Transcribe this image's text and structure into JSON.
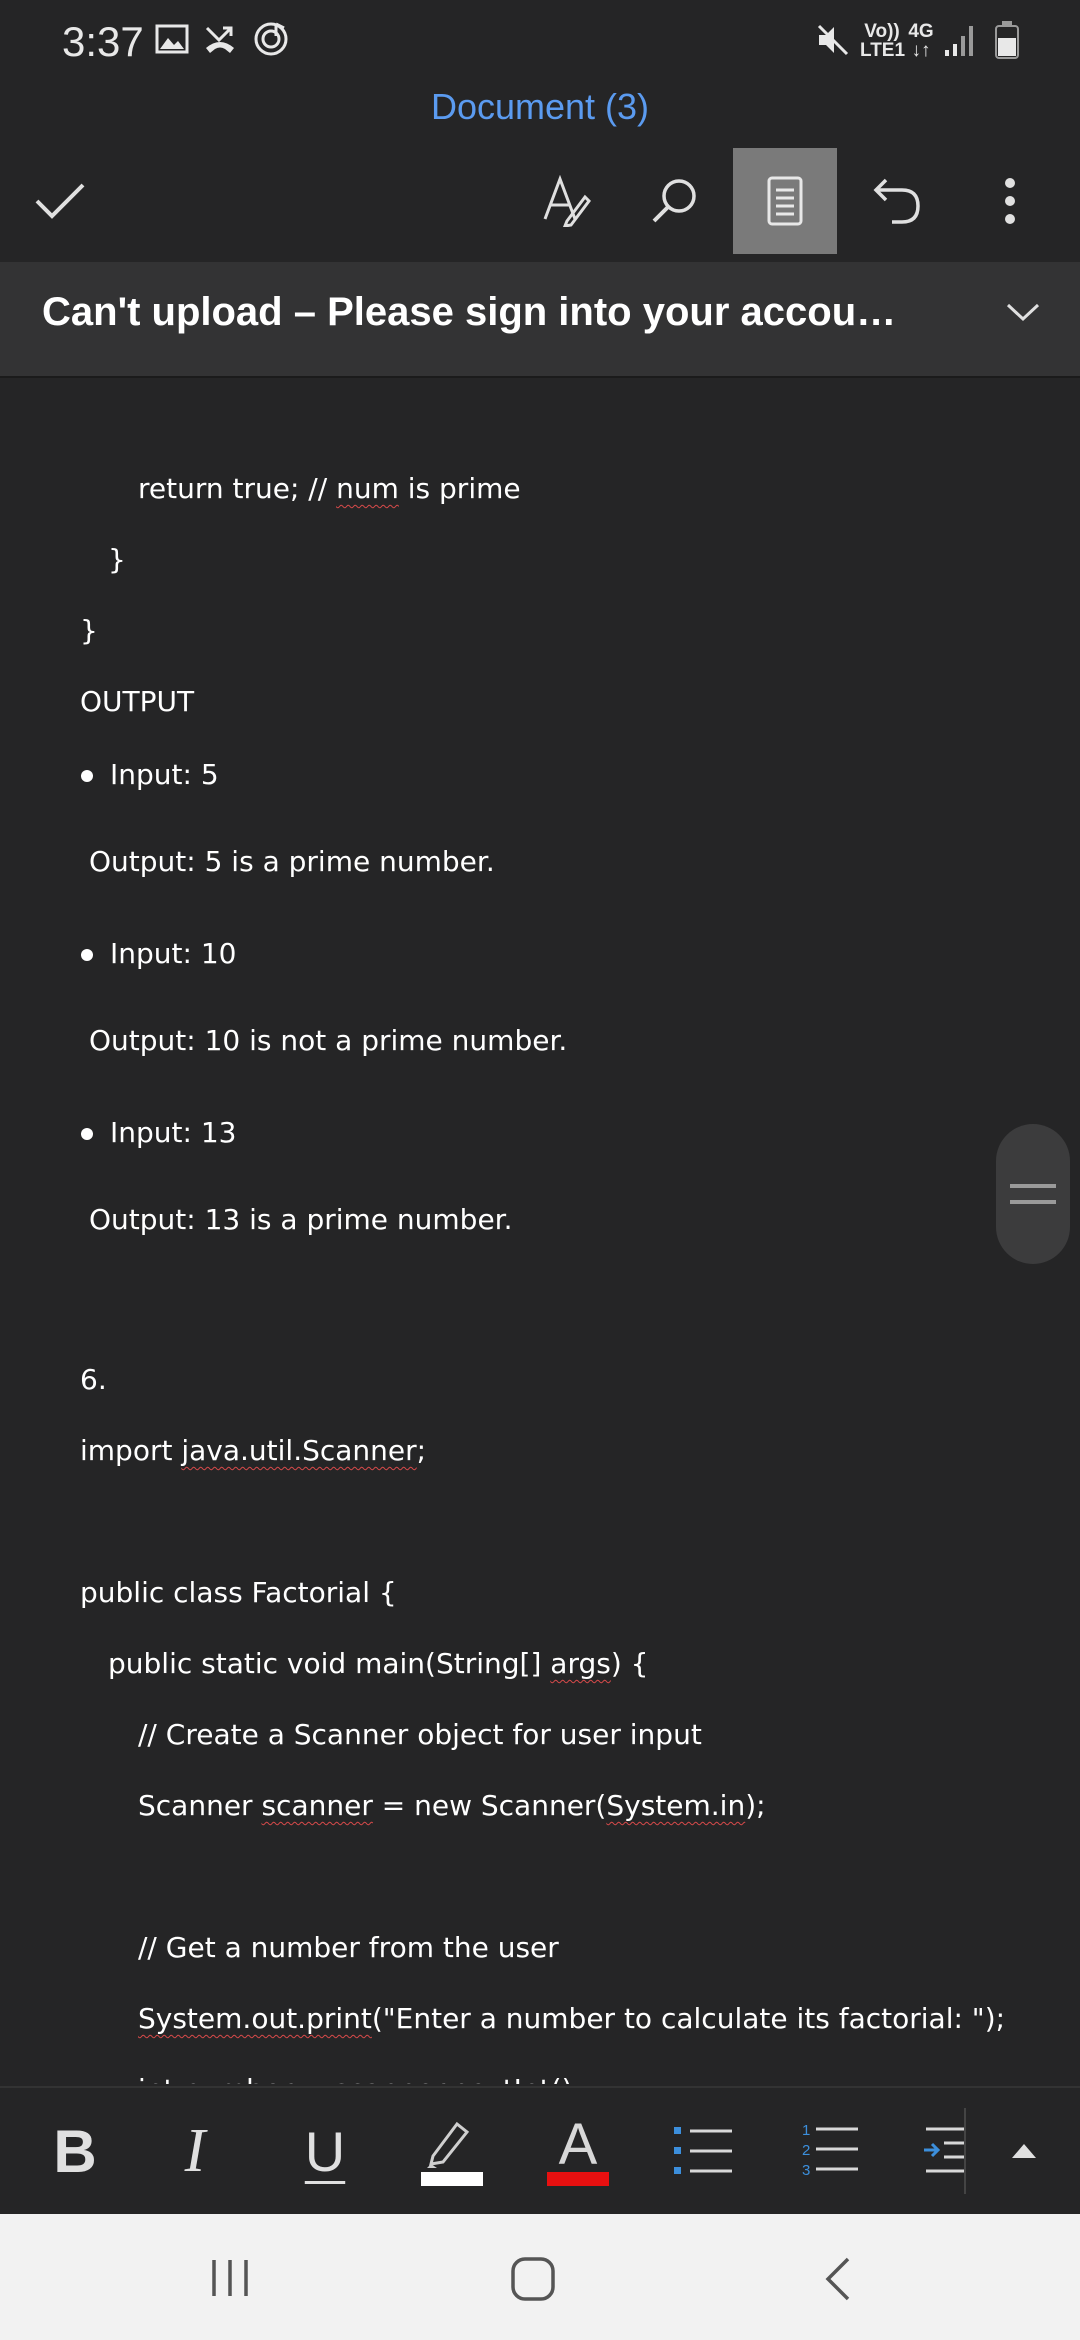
{
  "status_bar": {
    "time": "3:37",
    "icons": [
      "gallery-icon",
      "missed-call-icon",
      "music-sync-icon",
      "mute-icon",
      "volte-lte-icon",
      "4g-data-icon",
      "signal-icon",
      "battery-icon"
    ],
    "volte_line1": "Vo))",
    "volte_line2": "LTE1",
    "net_line1": "4G",
    "net_line2": "↓↑"
  },
  "header": {
    "title": "Document (3)",
    "title_color": "#5b9bf0"
  },
  "toolbar": {
    "buttons": [
      "done-check-icon",
      "draw-pen-icon",
      "search-icon",
      "mobile-view-icon",
      "undo-icon",
      "more-options-icon"
    ],
    "active_button": "mobile-view-icon"
  },
  "banner": {
    "text": "Can't upload – Please sign into your accou…"
  },
  "document": {
    "lines": [
      "return true; // ",
      "num",
      " is prime",
      "}",
      "}",
      "OUTPUT",
      "Input: 5",
      "Output: 5 is a prime number.",
      "Input: 10",
      "Output: 10 is not a prime number.",
      "Input: 13",
      "Output: 13 is a prime number.",
      "6.",
      "import ",
      "java.util.Scanner",
      ";",
      "public class Factorial {",
      "public static void main(String[] ",
      "args",
      ") {",
      "// Create a Scanner object for user input",
      "Scanner ",
      "scanner",
      " = new Scanner(",
      "System.in",
      ");",
      "// Get a number from the user",
      "System.out.print",
      "(\"Enter a number to calculate its factorial: \");",
      "int number = scanner.nextInt();"
    ]
  },
  "format_bar": {
    "bold": "B",
    "italic": "I",
    "underline": "U",
    "highlight_color": "#ffffff",
    "font_color_letter": "A",
    "font_color": "#e81010",
    "tools": [
      "bold-icon",
      "italic-icon",
      "underline-icon",
      "highlighter-icon",
      "font-color-icon",
      "bullet-list-icon",
      "numbered-list-icon",
      "indent-icon",
      "expand-up-icon"
    ]
  },
  "navbar": {
    "buttons": [
      "recent-apps-icon",
      "home-icon",
      "back-icon"
    ]
  }
}
